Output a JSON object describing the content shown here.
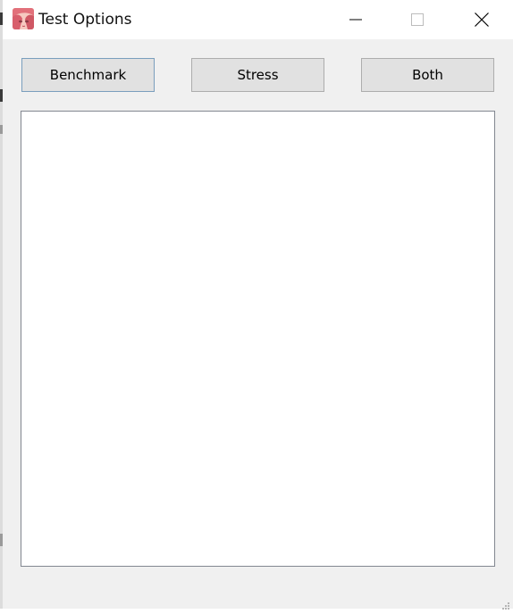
{
  "window": {
    "title": "Test Options",
    "controls": {
      "minimize": "minimize-icon",
      "maximize": "maximize-icon",
      "close": "close-icon"
    }
  },
  "actions": {
    "benchmark_label": "Benchmark",
    "stress_label": "Stress",
    "both_label": "Both"
  },
  "colors": {
    "titlebar_bg": "#ffffff",
    "window_bg": "#f0f0f0",
    "button_bg": "#e1e1e1",
    "button_border": "#adadad",
    "focused_button_border": "#7a9ebd",
    "panel_bg": "#ffffff"
  }
}
